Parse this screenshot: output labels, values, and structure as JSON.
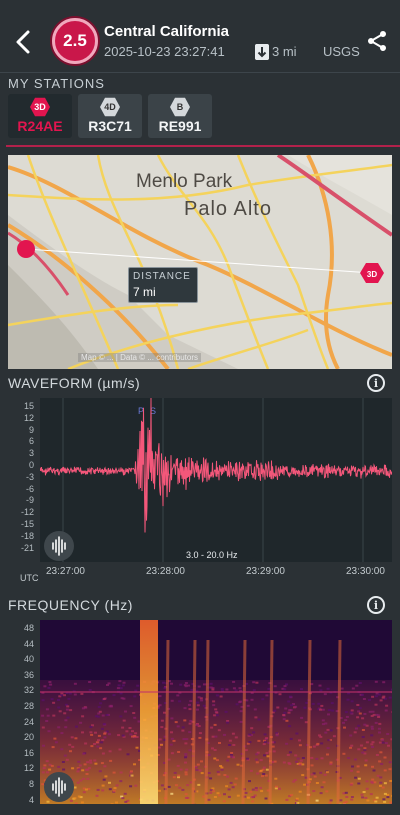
{
  "header": {
    "magnitude": "2.5",
    "region": "Central California",
    "datetime": "2025-10-23 23:27:41",
    "depth": "3 mi",
    "source": "USGS",
    "back_icon": "back-arrow-icon",
    "share_icon": "share-icon"
  },
  "stations": {
    "label": "MY STATIONS",
    "items": [
      {
        "badge": "3D",
        "name": "R24AE",
        "selected": true
      },
      {
        "badge": "4D",
        "name": "R3C71",
        "selected": false
      },
      {
        "badge": "B",
        "name": "RE991",
        "selected": false
      }
    ]
  },
  "map": {
    "city1": "Menlo Park",
    "city2": "Palo Alto",
    "distance_label": "DISTANCE",
    "distance_value": "7 mi",
    "station_badge": "3D",
    "attribution": "Map © ... | Data © ... contributors"
  },
  "waveform": {
    "title": "WAVEFORM (µm/s)",
    "y_ticks": [
      "15",
      "12",
      "9",
      "6",
      "3",
      "0",
      "-3",
      "-6",
      "-9",
      "-12",
      "-15",
      "-18",
      "-21"
    ],
    "x_ticks": [
      "23:27:00",
      "23:28:00",
      "23:29:00",
      "23:30:00"
    ],
    "utc": "UTC",
    "band": "3.0 - 20.0 Hz",
    "p_marker": "P",
    "s_marker": "S"
  },
  "frequency": {
    "title": "FREQUENCY (Hz)",
    "y_ticks": [
      "48",
      "44",
      "40",
      "36",
      "32",
      "28",
      "24",
      "20",
      "16",
      "12",
      "8",
      "4"
    ]
  },
  "colors": {
    "background": "#2b3135",
    "accent": "#e2154f",
    "waveform": "#f3577a"
  }
}
